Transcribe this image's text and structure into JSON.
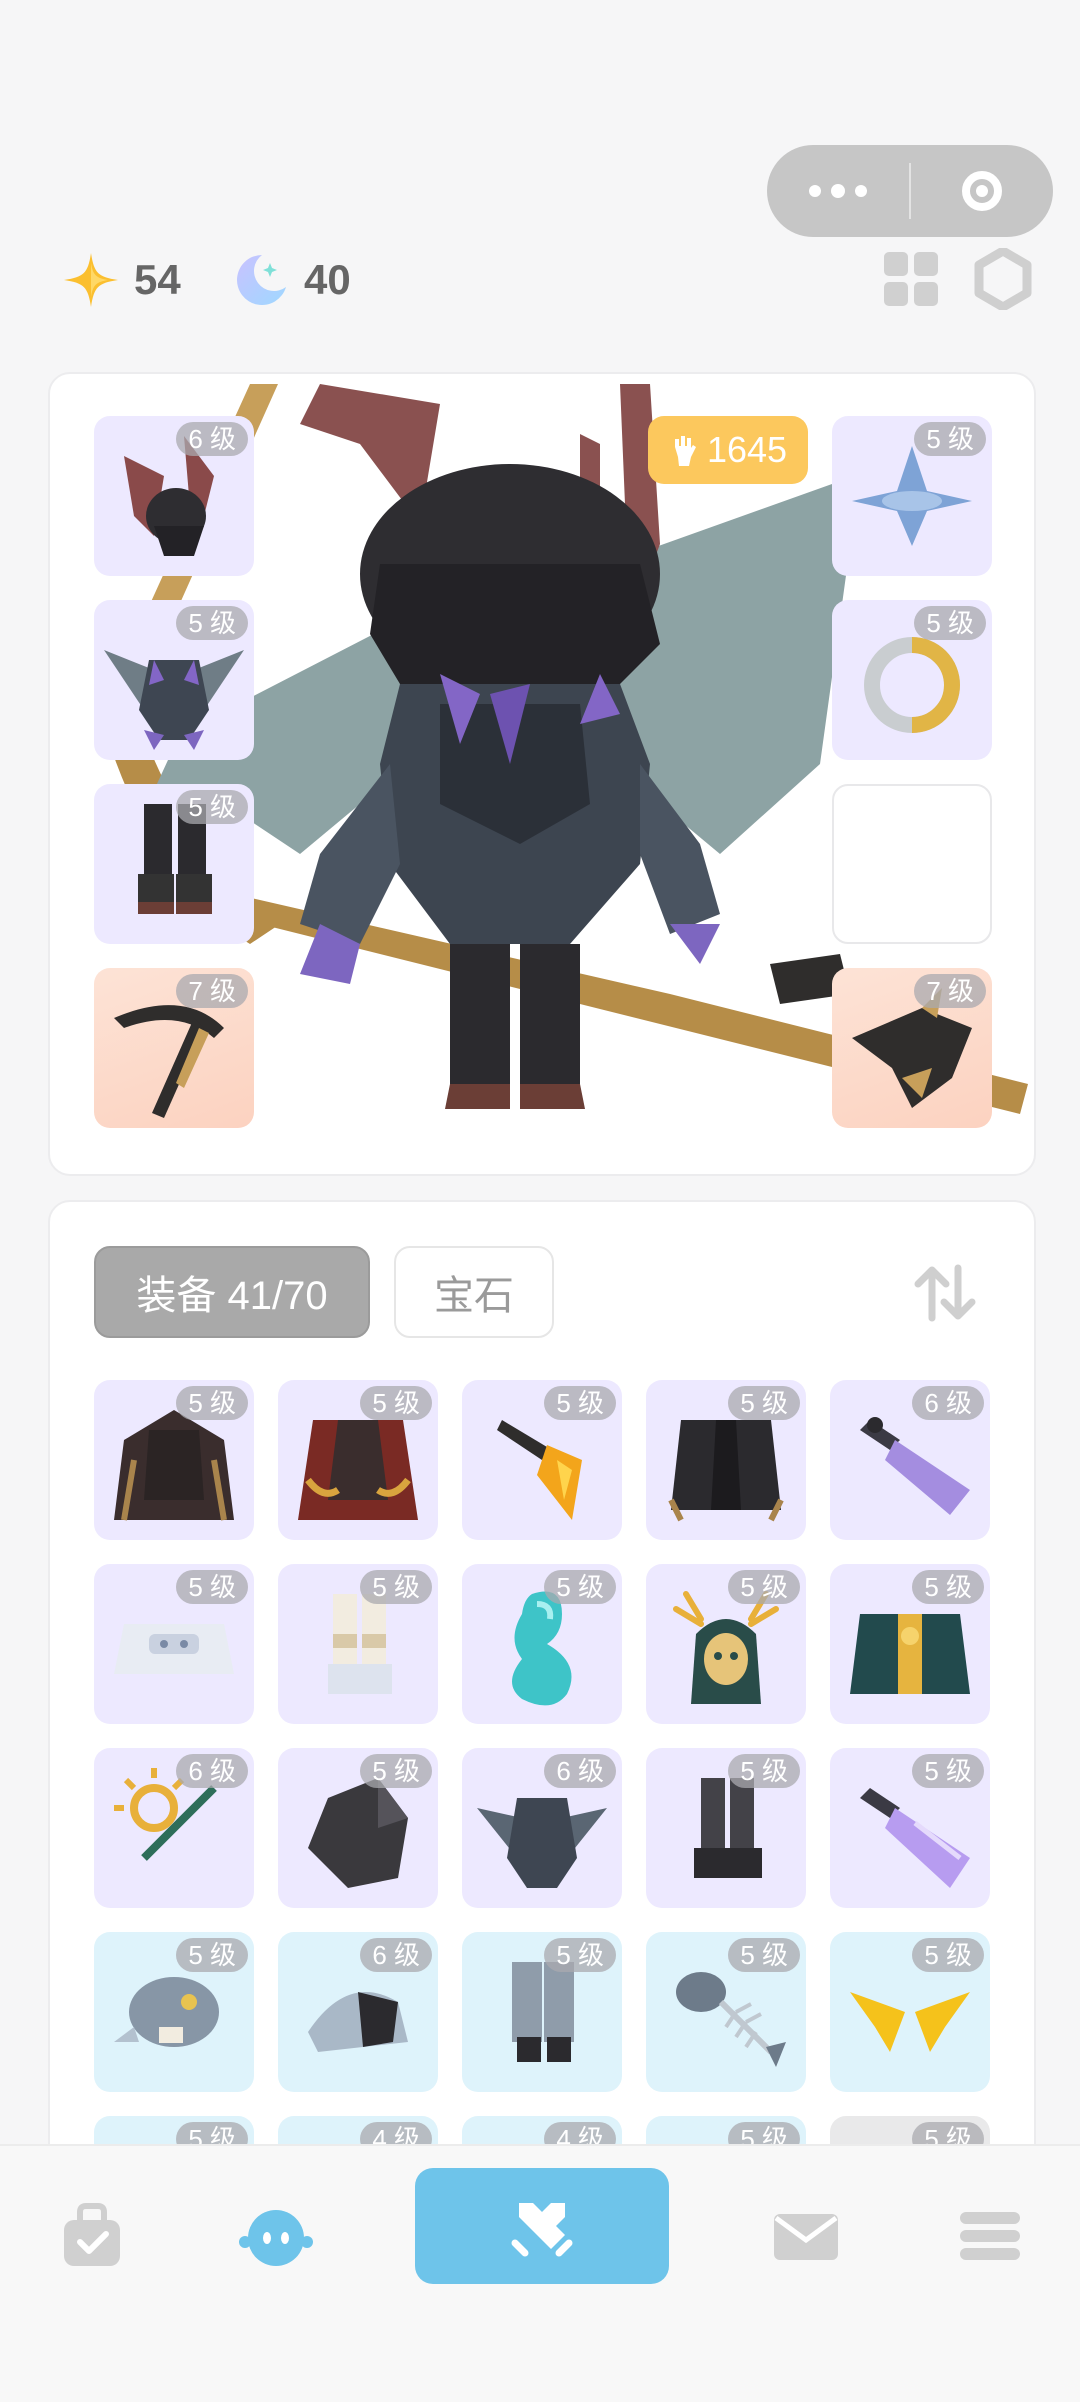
{
  "currency": {
    "stars": {
      "icon": "star-icon",
      "value": "54"
    },
    "moons": {
      "icon": "moon-icon",
      "value": "40"
    }
  },
  "character": {
    "power": "1645",
    "left_slots": [
      {
        "name": "helmet",
        "level": "6 级",
        "tone": "purple",
        "icon": "winged-helmet-icon"
      },
      {
        "name": "armor",
        "level": "5 级",
        "tone": "purple",
        "icon": "dragon-armor-icon"
      },
      {
        "name": "boots",
        "level": "5 级",
        "tone": "purple",
        "icon": "boots-icon"
      },
      {
        "name": "weapon",
        "level": "7 级",
        "tone": "orange",
        "icon": "scythe-icon"
      }
    ],
    "right_slots": [
      {
        "name": "hat",
        "level": "5 级",
        "tone": "purple",
        "icon": "spinner-hat-icon"
      },
      {
        "name": "ring",
        "level": "5 级",
        "tone": "purple",
        "icon": "serpent-ring-icon"
      },
      {
        "name": "empty",
        "level": "",
        "tone": "empty",
        "icon": ""
      },
      {
        "name": "offhand",
        "level": "7 级",
        "tone": "orange",
        "icon": "dragon-claw-icon"
      }
    ]
  },
  "tabs": {
    "equipment": "装备 41/70",
    "gems": "宝石"
  },
  "inventory": [
    {
      "level": "5 级",
      "tone": "purple",
      "icon": "dark-cape-icon"
    },
    {
      "level": "5 级",
      "tone": "purple",
      "icon": "red-cape-icon"
    },
    {
      "level": "5 级",
      "tone": "purple",
      "icon": "fire-dagger-icon"
    },
    {
      "level": "5 级",
      "tone": "purple",
      "icon": "black-coat-icon"
    },
    {
      "level": "6 级",
      "tone": "purple",
      "icon": "crystal-staff-icon"
    },
    {
      "level": "5 级",
      "tone": "purple",
      "icon": "robot-armor-icon"
    },
    {
      "level": "5 级",
      "tone": "purple",
      "icon": "white-boots-icon"
    },
    {
      "level": "5 级",
      "tone": "purple",
      "icon": "teal-potion-icon"
    },
    {
      "level": "5 级",
      "tone": "purple",
      "icon": "antler-hood-icon"
    },
    {
      "level": "5 级",
      "tone": "purple",
      "icon": "green-robe-icon"
    },
    {
      "level": "6 级",
      "tone": "purple",
      "icon": "sun-staff-icon"
    },
    {
      "level": "5 级",
      "tone": "purple",
      "icon": "dark-stone-icon"
    },
    {
      "level": "6 级",
      "tone": "purple",
      "icon": "dragon-chest-icon"
    },
    {
      "level": "5 级",
      "tone": "purple",
      "icon": "dark-boots-icon"
    },
    {
      "level": "5 级",
      "tone": "purple",
      "icon": "purple-sword-icon"
    },
    {
      "level": "5 级",
      "tone": "blue",
      "icon": "fish-helmet-icon"
    },
    {
      "level": "6 级",
      "tone": "blue",
      "icon": "fish-armor-icon"
    },
    {
      "level": "5 级",
      "tone": "blue",
      "icon": "grey-pants-icon"
    },
    {
      "level": "5 级",
      "tone": "blue",
      "icon": "fish-bone-icon"
    },
    {
      "level": "5 级",
      "tone": "blue",
      "icon": "gold-wings-icon"
    },
    {
      "level": "5 级",
      "tone": "blue",
      "icon": "item-icon"
    },
    {
      "level": "4 级",
      "tone": "blue",
      "icon": "item-icon"
    },
    {
      "level": "4 级",
      "tone": "blue",
      "icon": "item-icon"
    },
    {
      "level": "5 级",
      "tone": "blue",
      "icon": "item-icon"
    },
    {
      "level": "5 级",
      "tone": "grey",
      "icon": "item-icon"
    }
  ],
  "nav": [
    "bag-icon",
    "character-icon",
    "battle-icon",
    "mail-icon",
    "menu-icon"
  ],
  "colors": {
    "accent": "#6ec4ea",
    "power": "#fcc85d",
    "slot_purple": "#ede9ff",
    "slot_orange": "#fcd8c8",
    "slot_blue": "#def3fb"
  }
}
